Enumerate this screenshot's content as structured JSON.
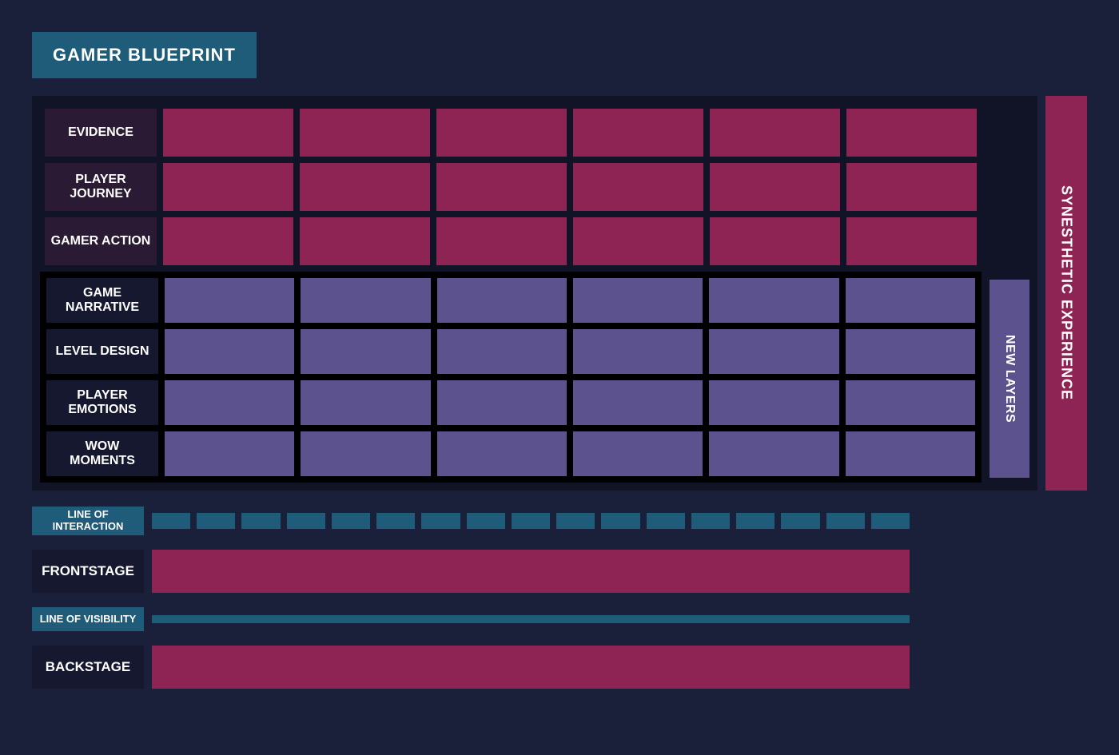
{
  "title": "GAMER BLUEPRINT",
  "gridColumns": 6,
  "topRows": [
    {
      "label": "EVIDENCE"
    },
    {
      "label": "PLAYER JOURNEY"
    },
    {
      "label": "GAMER ACTION"
    }
  ],
  "bottomRows": [
    {
      "label": "GAME NARRATIVE"
    },
    {
      "label": "LEVEL DESIGN"
    },
    {
      "label": "PLAYER EMOTIONS"
    },
    {
      "label": "WOW MOMENTS"
    }
  ],
  "sideLabels": {
    "newLayers": "NEW LAYERS",
    "synesthetic": "SYNESTHETIC EXPERIENCE"
  },
  "stages": {
    "lineOfInteraction": "LINE OF INTERACTION",
    "frontstage": "FRONTSTAGE",
    "lineOfVisibility": "LINE OF VISIBILITY",
    "backstage": "BACKSTAGE",
    "dashCount": 17
  },
  "colors": {
    "background": "#1a1f3a",
    "panel": "#111327",
    "teal": "#1e5c7a",
    "magenta": "#8e2454",
    "purple": "#5b528e",
    "darkLabel": "#15182e",
    "plumLabel": "#2a1a33"
  }
}
